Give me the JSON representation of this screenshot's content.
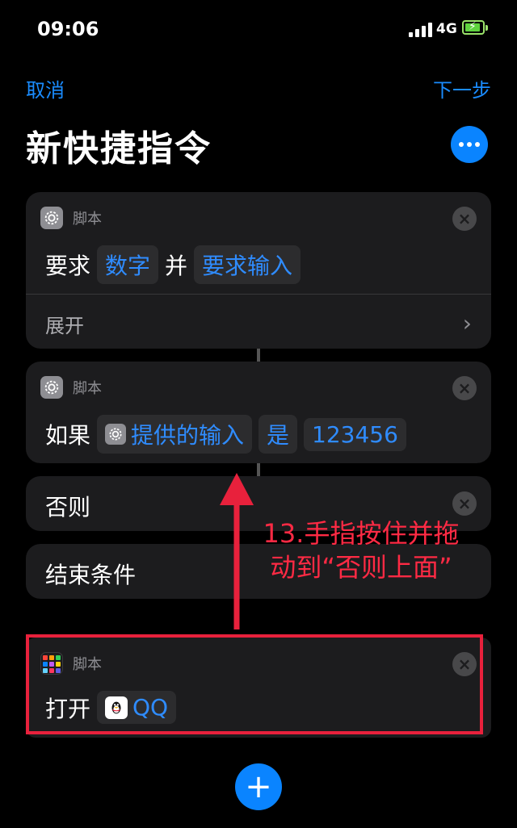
{
  "status": {
    "time": "09:06",
    "network": "4G"
  },
  "nav": {
    "cancel": "取消",
    "next": "下一步"
  },
  "title": "新快捷指令",
  "cards": {
    "ask": {
      "category": "脚本",
      "verb": "要求",
      "type_token": "数字",
      "joiner": "并",
      "prompt_token": "要求输入",
      "expand": "展开"
    },
    "if": {
      "category": "脚本",
      "verb": "如果",
      "input_token": "提供的输入",
      "operator_token": "是",
      "value_token": "123456"
    },
    "otherwise": {
      "label": "否则"
    },
    "end_if": {
      "label": "结束条件"
    },
    "open_app": {
      "category": "脚本",
      "verb": "打开",
      "app_token": "QQ"
    }
  },
  "annotation": {
    "text": "13.手指按住并拖动到“否则上面”"
  },
  "colors": {
    "accent": "#0a84ff",
    "link": "#1a8cff",
    "card": "#1c1c1e",
    "annotation": "#e8213c"
  },
  "icons": {
    "more": "more-dots-icon",
    "script": "gear-icon",
    "apps": "app-grid-icon",
    "qq": "qq-penguin-icon",
    "close": "close-icon",
    "add": "plus-icon"
  }
}
